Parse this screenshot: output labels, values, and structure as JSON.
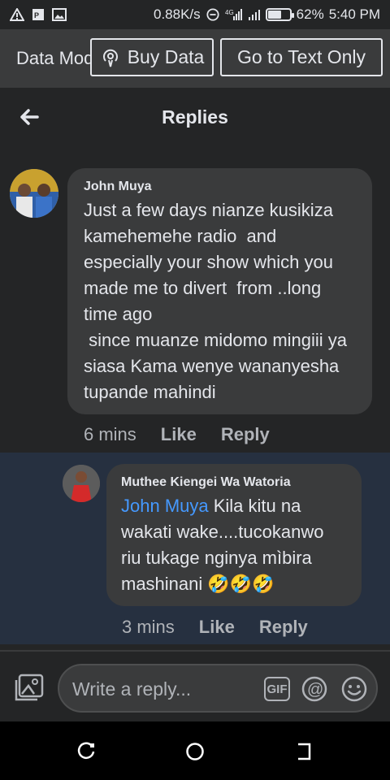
{
  "status_bar": {
    "speed": "0.88K/s",
    "signal_text": "⁴ᴳ",
    "battery": "62%",
    "battery_level": 0.62,
    "time": "5:40 PM"
  },
  "data_bar": {
    "mode_label": "Data Mode",
    "buy_label": "Buy Data",
    "text_only_label": "Go to Text Only"
  },
  "header": {
    "title": "Replies"
  },
  "comment": {
    "author": "John Muya",
    "text": "Just a few days nianze kusikiza kamehemehe radio  and especially your show which you made me to divert  from ..long time ago\n since muanze midomo mingiii ya siasa Kama wenye wananyesha tupande mahindi",
    "time": "6 mins",
    "like_label": "Like",
    "reply_label": "Reply"
  },
  "reply": {
    "author": "Muthee Kiengei Wa Watoria",
    "mention": "John Muya",
    "text": " Kila kitu na wakati wake....tucokanwo riu tukage nginya mìbira mashinani 🤣🤣🤣",
    "time": "3 mins",
    "like_label": "Like",
    "reply_label": "Reply"
  },
  "composer": {
    "placeholder": "Write a reply...",
    "gif_label": "GIF"
  },
  "colors": {
    "background": "#242526",
    "bubble": "#3a3b3c",
    "highlight": "#263040",
    "mention": "#4599ff",
    "muted_text": "#b0b3b8"
  }
}
